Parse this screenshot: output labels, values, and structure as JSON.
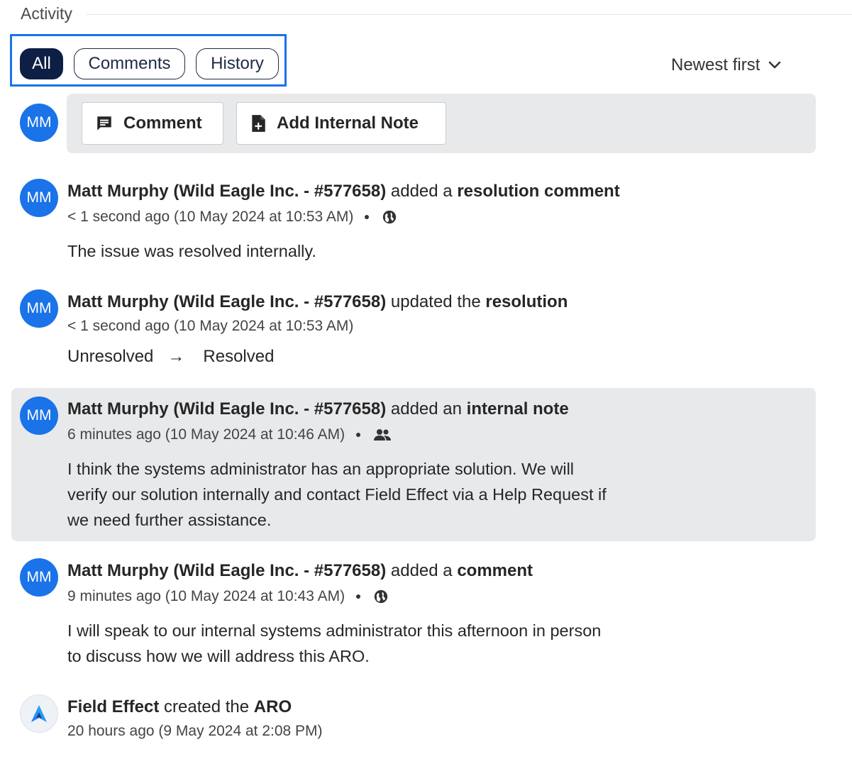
{
  "header": {
    "title": "Activity"
  },
  "filters": {
    "tabs": [
      {
        "label": "All",
        "active": true
      },
      {
        "label": "Comments",
        "active": false
      },
      {
        "label": "History",
        "active": false
      }
    ],
    "sort_label": "Newest first"
  },
  "composer": {
    "avatar": "MM",
    "comment_label": "Comment",
    "internal_note_label": "Add Internal Note"
  },
  "entries": [
    {
      "avatar": "MM",
      "actor": "Matt Murphy (Wild Eagle Inc. - #577658)",
      "verb": "added a",
      "object": "resolution comment",
      "time": "< 1 second ago (10 May 2024 at 10:53 AM)",
      "visibility_icon": "globe-icon",
      "body": "The issue was resolved internally."
    },
    {
      "avatar": "MM",
      "actor": "Matt Murphy (Wild Eagle Inc. - #577658)",
      "verb": "updated the",
      "object": "resolution",
      "time": "< 1 second ago (10 May 2024 at 10:53 AM)",
      "change_from": "Unresolved",
      "change_arrow": "→",
      "change_to": "Resolved"
    },
    {
      "avatar": "MM",
      "actor": "Matt Murphy (Wild Eagle Inc. - #577658)",
      "verb": "added an",
      "object": "internal note",
      "time": "6 minutes ago (10 May 2024 at 10:46 AM)",
      "visibility_icon": "people-icon",
      "body_lines": [
        "I think the systems administrator has an appropriate solution. We will",
        "verify our solution internally and contact Field Effect via a Help Request if",
        "we need further assistance."
      ]
    },
    {
      "avatar": "MM",
      "actor": "Matt Murphy (Wild Eagle Inc. - #577658)",
      "verb": "added a",
      "object": "comment",
      "time": "9 minutes ago (10 May 2024 at 10:43 AM)",
      "visibility_icon": "globe-icon",
      "body_lines": [
        "I will speak to our internal systems administrator this afternoon in person",
        "to discuss how we will address this ARO."
      ]
    },
    {
      "avatar_icon": "field-effect-logo-icon",
      "actor": "Field Effect",
      "verb": "created the",
      "object": "ARO",
      "time": "20 hours ago (9 May 2024 at 2:08 PM)"
    }
  ],
  "colors": {
    "accent": "#1a73e8",
    "tab_active": "#0e1f45",
    "panel": "#e8e9eb"
  }
}
